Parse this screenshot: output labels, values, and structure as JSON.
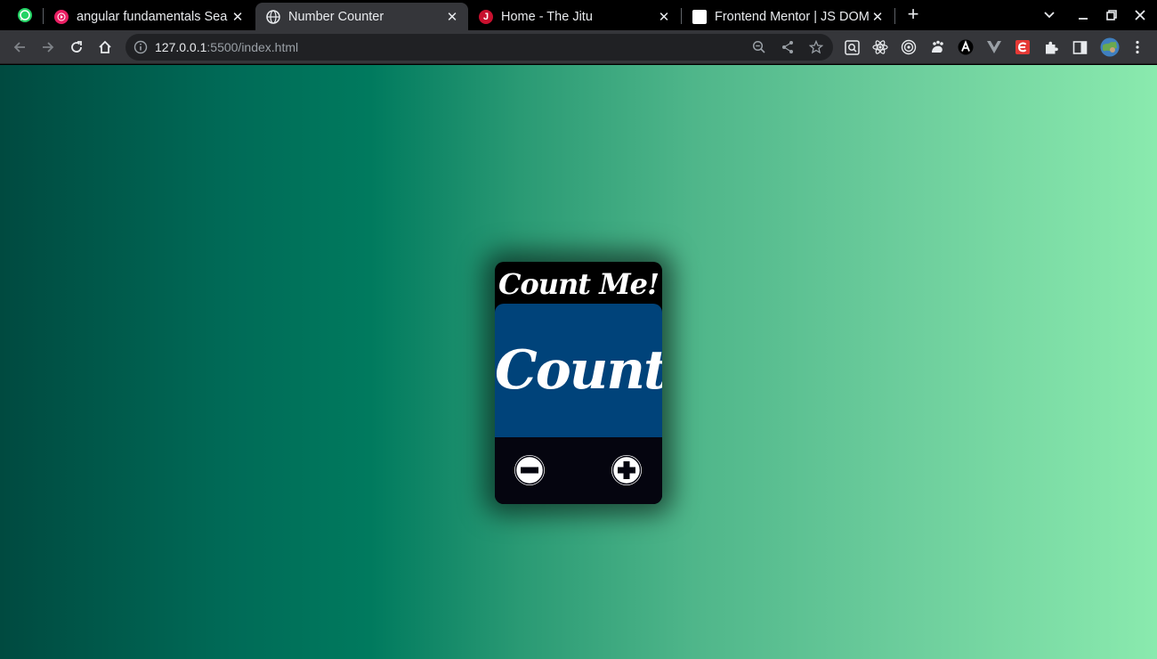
{
  "browser": {
    "tabs": [
      {
        "title": "angular fundamentals Sea",
        "favicon": "youtube-music-icon",
        "active": false
      },
      {
        "title": "Number Counter",
        "favicon": "globe-icon",
        "active": true
      },
      {
        "title": "Home - The Jitu",
        "favicon": "jitu-icon",
        "active": false
      },
      {
        "title": "Frontend Mentor | JS DOM",
        "favicon": "document-icon",
        "active": false
      }
    ],
    "pinned_tab_icon": "whatsapp-icon",
    "url_host": "127.0.0.1",
    "url_rest": ":5500/index.html"
  },
  "app": {
    "title": "Count Me!",
    "display_value": "Count",
    "decrement_icon": "minus-circle-icon",
    "increment_icon": "plus-circle-icon"
  },
  "colors": {
    "card_background": "#000000",
    "display_background": "#00437a",
    "page_gradient_start": "#004a40",
    "page_gradient_end": "#8aeaae"
  }
}
